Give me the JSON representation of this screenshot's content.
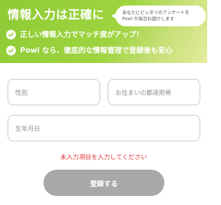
{
  "banner": {
    "title": "情報入力は正確に",
    "bubble": {
      "line1": "あなたにピッタリのアンケートを",
      "line2": "Powl が毎日お届けします"
    },
    "benefits": [
      {
        "icon": "check-badge-icon",
        "text": "正しい情報入力でマッチ度がアップ！"
      },
      {
        "icon": "check-badge-icon",
        "text": "Powl なら、徹底的な情報管理で登録後も安心"
      }
    ]
  },
  "form": {
    "gender_placeholder": "性別",
    "prefecture_placeholder": "お住まいの都道府県",
    "birthdate_placeholder": "生年月日"
  },
  "error_message": "未入力項目を入力してください",
  "submit_label": "登録する",
  "colors": {
    "banner_green": "#9fd43f",
    "error_red": "#e0353a",
    "button_disabled": "#a8a8a8"
  }
}
